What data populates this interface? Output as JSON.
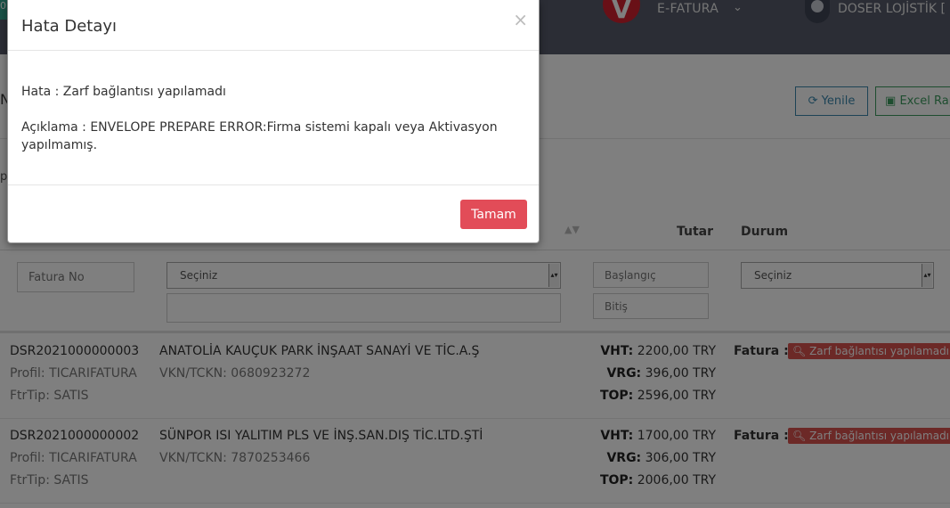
{
  "header": {
    "badge": "0",
    "logo_letter": "V",
    "app_name": "E-FATURA",
    "user_name": "DOSER LOJİSTİK [ D"
  },
  "page": {
    "title_fragment": "N",
    "side_fragment": "p",
    "refresh_label": "Yenile",
    "excel_label": "Excel Rap"
  },
  "table": {
    "headers": {
      "tutar": "Tutar",
      "durum": "Durum"
    },
    "filters": {
      "fatura_no_placeholder": "Fatura No",
      "select_placeholder": "Seçiniz",
      "baslangic_placeholder": "Başlangıç",
      "bitis_placeholder": "Bitiş",
      "durum_select": "Seçiniz"
    },
    "rows": [
      {
        "code": "DSR2021000000003",
        "profil": "Profil: TICARIFATURA",
        "ftrtip": "FtrTip: SATIS",
        "company": "ANATOLİA KAUÇUK PARK İNŞAAT SANAYİ VE TİC.A.Ş",
        "vkn": "VKN/TCKN: 0680923272",
        "vht_label": "VHT:",
        "vht": "2200,00 TRY",
        "vrg_label": "VRG:",
        "vrg": "396,00 TRY",
        "top_label": "TOP:",
        "top": "2596,00 TRY",
        "status_label": "Fatura :",
        "status": "Zarf bağlantısı yapılamadı"
      },
      {
        "code": "DSR2021000000002",
        "profil": "Profil: TICARIFATURA",
        "ftrtip": "FtrTip: SATIS",
        "company": "SÜNPOR ISI YALITIM PLS VE İNŞ.SAN.DIŞ TİC.LTD.ŞTİ",
        "vkn": "VKN/TCKN: 7870253466",
        "vht_label": "VHT:",
        "vht": "1700,00 TRY",
        "vrg_label": "VRG:",
        "vrg": "306,00 TRY",
        "top_label": "TOP:",
        "top": "2006,00 TRY",
        "status_label": "Fatura :",
        "status": "Zarf bağlantısı yapılamadı"
      }
    ]
  },
  "modal": {
    "title": "Hata Detayı",
    "close": "×",
    "error_line": "Hata : Zarf bağlantısı yapılamadı",
    "description_line": "Açıklama : ENVELOPE PREPARE ERROR:Firma sistemi kapalı veya Aktivasyon yapılmamış.",
    "ok_label": "Tamam"
  },
  "colors": {
    "header_bg": "#565b6b",
    "logo_red": "#d3202e",
    "danger": "#d9534f",
    "ok_button": "#e24c58",
    "refresh_blue": "#3a87ad",
    "excel_green": "#3c9a5f"
  }
}
